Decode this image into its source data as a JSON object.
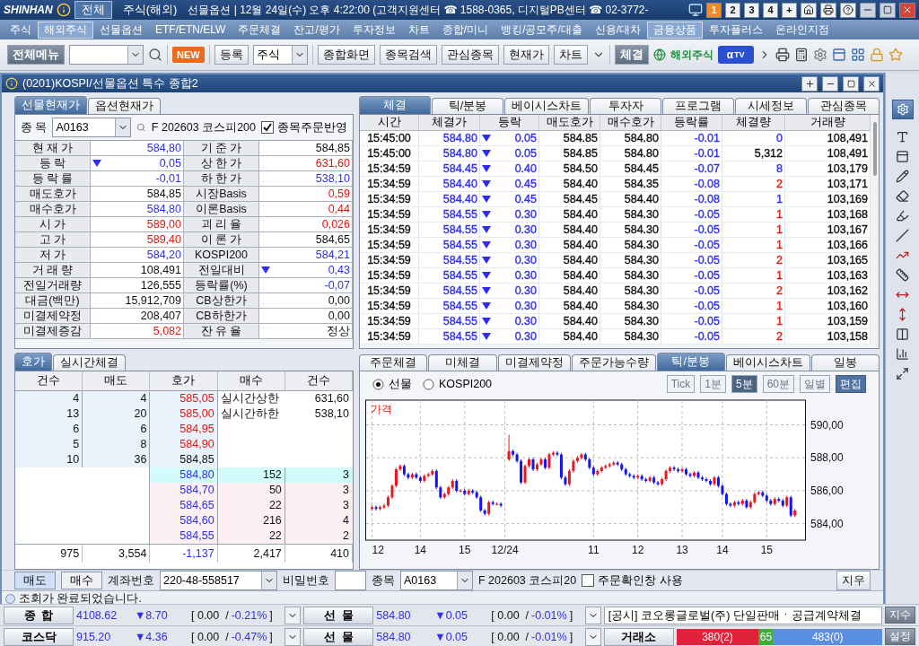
{
  "top_bar": {
    "logo": "SHINHAN",
    "tabs": [
      {
        "label": "전체",
        "selected": true
      },
      {
        "label": "주식(해외)",
        "selected": false
      }
    ],
    "info": "선물옵션 | 12월 24일(수) 오후 4:22:00 (고객지원센터 ☎ 1588-0365, 디지털PB센터 ☎ 02-3772-",
    "screens": [
      {
        "label": "1",
        "selected": true
      },
      {
        "label": "2",
        "selected": false
      },
      {
        "label": "3",
        "selected": false
      },
      {
        "label": "4",
        "selected": false
      },
      {
        "label": "+",
        "selected": false
      }
    ]
  },
  "menu": [
    {
      "label": "주식",
      "selected": false
    },
    {
      "label": "해외주식",
      "selected": true
    },
    {
      "label": "선물옵션",
      "selected": false
    },
    {
      "label": "ETF/ETN/ELW",
      "selected": false
    },
    {
      "label": "주문체결",
      "selected": false
    },
    {
      "label": "잔고/평가",
      "selected": false
    },
    {
      "label": "투자정보",
      "selected": false
    },
    {
      "label": "차트",
      "selected": false
    },
    {
      "label": "종합/미니",
      "selected": false
    },
    {
      "label": "뱅킹/공모주/대출",
      "selected": false
    },
    {
      "label": "신용/대차",
      "selected": false
    },
    {
      "label": "금융상품",
      "selected": true
    },
    {
      "label": "투자플러스",
      "selected": false
    },
    {
      "label": "온라인지점",
      "selected": false
    }
  ],
  "toolbar": {
    "all_menu": "전체메뉴",
    "new_badge": "NEW",
    "register": "등록",
    "market": "주식",
    "shortcuts": [
      "종합화면",
      "종목검색",
      "관심종목",
      "현재가",
      "차트"
    ],
    "trade": "체결",
    "overseas": "해외주식",
    "tv_logo": {
      "mark": "α",
      "label": "TV"
    }
  },
  "window": {
    "title": "(0201)KOSPI/선물옵션 특수 종합2"
  },
  "quote_panel": {
    "tabs": [
      {
        "label": "선물현재가",
        "selected": true
      },
      {
        "label": "옵션현재가",
        "selected": false
      }
    ],
    "code_label": "종 목",
    "code": "A0163",
    "name": "F 202603 코스피200",
    "reflect": {
      "label": "종목주문반영",
      "checked": true
    },
    "rows": [
      [
        {
          "label": "현 재 가",
          "value": "584,80",
          "color": "#2e2ef2"
        },
        {
          "label": "기 준 가",
          "value": "584,85",
          "color": "#111111"
        }
      ],
      [
        {
          "label": "등      락",
          "value": "0,05",
          "color": "#2e2ef2",
          "down_arrow": true
        },
        {
          "label": "상 한 가",
          "value": "631,60",
          "color": "#e3160f"
        }
      ],
      [
        {
          "label": "등 락 률",
          "value": "-0,01",
          "color": "#2e2ef2"
        },
        {
          "label": "하 한 가",
          "value": "538,10",
          "color": "#2e2ef2"
        }
      ],
      [
        {
          "label": "매도호가",
          "value": "584,85",
          "color": "#111111"
        },
        {
          "label": "시장Basis",
          "value": "0,59",
          "color": "#e3160f"
        }
      ],
      [
        {
          "label": "매수호가",
          "value": "584,80",
          "color": "#2e2ef2"
        },
        {
          "label": "이론Basis",
          "value": "0,44",
          "color": "#e3160f"
        }
      ],
      [
        {
          "label": "시      가",
          "value": "589,00",
          "color": "#e3160f"
        },
        {
          "label": "괴 리 율",
          "value": "0,026",
          "color": "#e3160f"
        }
      ],
      [
        {
          "label": "고      가",
          "value": "589,40",
          "color": "#e3160f"
        },
        {
          "label": "이 론 가",
          "value": "584,65",
          "color": "#111111"
        }
      ],
      [
        {
          "label": "저      가",
          "value": "584,20",
          "color": "#2e2ef2"
        },
        {
          "label": "KOSPI200",
          "value": "584,21",
          "color": "#2e2ef2"
        }
      ],
      [
        {
          "label": "거 래 량",
          "value": "108,491",
          "color": "#111111"
        },
        {
          "label": "전일대비",
          "value": "0,43",
          "color": "#2e2ef2",
          "down_arrow": true
        }
      ],
      [
        {
          "label": "전일거래량",
          "value": "126,555",
          "color": "#111111"
        },
        {
          "label": "등락률(%)",
          "value": "-0,07",
          "color": "#2e2ef2"
        }
      ],
      [
        {
          "label": "대금(백만)",
          "value": "15,912,709",
          "color": "#111111"
        },
        {
          "label": "CB상한가",
          "value": "0,00",
          "color": "#111111"
        }
      ],
      [
        {
          "label": "미결제약정",
          "value": "208,407",
          "color": "#111111"
        },
        {
          "label": "CB하한가",
          "value": "0,00",
          "color": "#111111"
        }
      ],
      [
        {
          "label": "미결제증감",
          "value": "5,082",
          "color": "#e3160f"
        },
        {
          "label": "잔 유 율",
          "value": "정상",
          "color": "#111111"
        }
      ]
    ]
  },
  "trades_panel": {
    "tabs": [
      {
        "label": "체결",
        "selected": true
      },
      {
        "label": "틱/분봉",
        "selected": false
      },
      {
        "label": "베이시스차트",
        "selected": false
      },
      {
        "label": "투자자",
        "selected": false
      },
      {
        "label": "프로그램",
        "selected": false
      },
      {
        "label": "시세정보",
        "selected": false
      },
      {
        "label": "관심종목",
        "selected": false
      }
    ],
    "columns": [
      "시간",
      "체결가",
      "등락",
      "매도호가",
      "매수호가",
      "등락률",
      "체결량",
      "거래량"
    ],
    "rows": [
      {
        "time": "15:45:00",
        "price": "584.80",
        "color": "#2e2ef2",
        "down_arrow": true,
        "change": "0.05",
        "ask": "584.85",
        "bid": "584.80",
        "rate": "-0.01",
        "qty": {
          "text": "0",
          "color": "#2e2ef2"
        },
        "volume": "108,491"
      },
      {
        "time": "15:45:00",
        "price": "584.80",
        "color": "#2e2ef2",
        "down_arrow": true,
        "change": "0.05",
        "ask": "584.85",
        "bid": "584.80",
        "rate": "-0.01",
        "qty": {
          "text": "5,312",
          "color": "#111111"
        },
        "volume": "108,491"
      },
      {
        "time": "15:34:59",
        "price": "584.45",
        "color": "#2e2ef2",
        "down_arrow": true,
        "change": "0.40",
        "ask": "584.50",
        "bid": "584.45",
        "rate": "-0.07",
        "qty": {
          "text": "8",
          "color": "#2e2ef2"
        },
        "volume": "103,179"
      },
      {
        "time": "15:34:59",
        "price": "584.40",
        "color": "#2e2ef2",
        "down_arrow": true,
        "change": "0.45",
        "ask": "584.40",
        "bid": "584.35",
        "rate": "-0.08",
        "qty": {
          "text": "2",
          "color": "#e3160f"
        },
        "volume": "103,171"
      },
      {
        "time": "15:34:59",
        "price": "584.40",
        "color": "#2e2ef2",
        "down_arrow": true,
        "change": "0.45",
        "ask": "584.45",
        "bid": "584.40",
        "rate": "-0.08",
        "qty": {
          "text": "1",
          "color": "#2e2ef2"
        },
        "volume": "103,169"
      },
      {
        "time": "15:34:59",
        "price": "584.55",
        "color": "#2e2ef2",
        "down_arrow": true,
        "change": "0.30",
        "ask": "584.40",
        "bid": "584.30",
        "rate": "-0.05",
        "qty": {
          "text": "1",
          "color": "#e3160f"
        },
        "volume": "103,168"
      },
      {
        "time": "15:34:59",
        "price": "584.55",
        "color": "#2e2ef2",
        "down_arrow": true,
        "change": "0.30",
        "ask": "584.40",
        "bid": "584.30",
        "rate": "-0.05",
        "qty": {
          "text": "1",
          "color": "#e3160f"
        },
        "volume": "103,167"
      },
      {
        "time": "15:34:59",
        "price": "584.55",
        "color": "#2e2ef2",
        "down_arrow": true,
        "change": "0.30",
        "ask": "584.40",
        "bid": "584.30",
        "rate": "-0.05",
        "qty": {
          "text": "1",
          "color": "#e3160f"
        },
        "volume": "103,166"
      },
      {
        "time": "15:34:59",
        "price": "584.55",
        "color": "#2e2ef2",
        "down_arrow": true,
        "change": "0.30",
        "ask": "584.40",
        "bid": "584.30",
        "rate": "-0.05",
        "qty": {
          "text": "2",
          "color": "#e3160f"
        },
        "volume": "103,165"
      },
      {
        "time": "15:34:59",
        "price": "584.55",
        "color": "#2e2ef2",
        "down_arrow": true,
        "change": "0.30",
        "ask": "584.40",
        "bid": "584.30",
        "rate": "-0.05",
        "qty": {
          "text": "1",
          "color": "#e3160f"
        },
        "volume": "103,163"
      },
      {
        "time": "15:34:59",
        "price": "584.55",
        "color": "#2e2ef2",
        "down_arrow": true,
        "change": "0.30",
        "ask": "584.40",
        "bid": "584.30",
        "rate": "-0.05",
        "qty": {
          "text": "2",
          "color": "#e3160f"
        },
        "volume": "103,162"
      },
      {
        "time": "15:34:59",
        "price": "584.55",
        "color": "#2e2ef2",
        "down_arrow": true,
        "change": "0.30",
        "ask": "584.40",
        "bid": "584.30",
        "rate": "-0.05",
        "qty": {
          "text": "1",
          "color": "#e3160f"
        },
        "volume": "103,160"
      },
      {
        "time": "15:34:59",
        "price": "584.55",
        "color": "#2e2ef2",
        "down_arrow": true,
        "change": "0.30",
        "ask": "584.40",
        "bid": "584.30",
        "rate": "-0.05",
        "qty": {
          "text": "1",
          "color": "#e3160f"
        },
        "volume": "103,159"
      },
      {
        "time": "15:34:59",
        "price": "584.55",
        "color": "#2e2ef2",
        "down_arrow": true,
        "change": "0.30",
        "ask": "584.40",
        "bid": "584.30",
        "rate": "-0.05",
        "qty": {
          "text": "2",
          "color": "#e3160f"
        },
        "volume": "103,158"
      }
    ]
  },
  "orderbook": {
    "tabs": [
      {
        "label": "호가",
        "selected": true
      },
      {
        "label": "실시간체결",
        "selected": false
      }
    ],
    "columns": [
      "건수",
      "매도",
      "호가",
      "매수",
      "건수"
    ],
    "asks": [
      {
        "count": "4",
        "qty": "4",
        "price": "585,05",
        "color": "#e3160f"
      },
      {
        "count": "13",
        "qty": "20",
        "price": "585,00",
        "color": "#e3160f"
      },
      {
        "count": "6",
        "qty": "6",
        "price": "584,95",
        "color": "#e3160f"
      },
      {
        "count": "5",
        "qty": "8",
        "price": "584,90",
        "color": "#e3160f"
      },
      {
        "count": "10",
        "qty": "36",
        "price": "584,85",
        "color": "#111111"
      }
    ],
    "limits": [
      {
        "label": "실시간상한",
        "value": "631,60"
      },
      {
        "label": "실시간하한",
        "value": "538,10"
      }
    ],
    "bids": [
      {
        "price": "584,80",
        "qty": "152",
        "count": "3",
        "color": "#2e2ef2",
        "current": true
      },
      {
        "price": "584,70",
        "qty": "50",
        "count": "3",
        "color": "#2e2ef2",
        "current": false
      },
      {
        "price": "584,65",
        "qty": "22",
        "count": "3",
        "color": "#2e2ef2",
        "current": false
      },
      {
        "price": "584,60",
        "qty": "216",
        "count": "4",
        "color": "#2e2ef2",
        "current": false
      },
      {
        "price": "584,55",
        "qty": "22",
        "count": "2",
        "color": "#2e2ef2",
        "current": false
      }
    ],
    "totals": [
      {
        "text": "975",
        "color": "#111111"
      },
      {
        "text": "3,554",
        "color": "#111111"
      },
      {
        "text": "-1,137",
        "color": "#2e2ef2"
      },
      {
        "text": "2,417",
        "color": "#111111"
      },
      {
        "text": "410",
        "color": "#111111"
      }
    ]
  },
  "chart_panel": {
    "tabs": [
      {
        "label": "주문체결",
        "selected": false
      },
      {
        "label": "미체결",
        "selected": false
      },
      {
        "label": "미결제약정",
        "selected": false
      },
      {
        "label": "주문가능수량",
        "selected": false
      },
      {
        "label": "틱/분봉",
        "selected": true
      },
      {
        "label": "베이시스차트",
        "selected": false
      },
      {
        "label": "일봉",
        "selected": false
      }
    ],
    "sources": [
      {
        "label": "선물",
        "selected": true
      },
      {
        "label": "KOSPI200",
        "selected": false
      }
    ],
    "periods": [
      {
        "label": "Tick",
        "selected": false
      },
      {
        "label": "1분",
        "selected": false
      },
      {
        "label": "5분",
        "selected": true
      },
      {
        "label": "60분",
        "selected": false
      },
      {
        "label": "일별",
        "selected": false
      }
    ],
    "edit": "편집",
    "chart_data": {
      "type": "candlestick",
      "ylabel": "가격",
      "grid": true,
      "ylim": [
        583.0,
        591.5
      ],
      "yticks": [
        {
          "value": 590,
          "label": "590,00"
        },
        {
          "value": 588,
          "label": "588,00"
        },
        {
          "value": 586,
          "label": "586,00"
        },
        {
          "value": 584,
          "label": "584,00"
        }
      ],
      "categories": [
        "12",
        null,
        null,
        null,
        null,
        null,
        null,
        null,
        null,
        null,
        null,
        null,
        "14",
        null,
        null,
        null,
        null,
        null,
        null,
        null,
        null,
        null,
        null,
        "15",
        null,
        null,
        null,
        null,
        null,
        null,
        null,
        null,
        null,
        "12/24",
        null,
        null,
        null,
        null,
        null,
        null,
        null,
        null,
        null,
        null,
        null,
        null,
        null,
        null,
        null,
        null,
        null,
        null,
        null,
        null,
        null,
        "11",
        null,
        null,
        null,
        null,
        null,
        null,
        null,
        null,
        null,
        null,
        "12",
        null,
        null,
        null,
        null,
        null,
        null,
        null,
        null,
        null,
        null,
        "13",
        null,
        null,
        null,
        null,
        null,
        null,
        null,
        null,
        null,
        "14",
        null,
        null,
        null,
        null,
        null,
        null,
        null,
        null,
        null,
        null,
        "15",
        null,
        null,
        null,
        null,
        null,
        null,
        null
      ],
      "ohlc": [
        [
          584.9,
          585.1,
          584.8,
          585.0
        ],
        [
          585.0,
          585.1,
          584.8,
          584.9
        ],
        [
          584.9,
          585.1,
          584.8,
          585.0
        ],
        [
          585.0,
          585.2,
          584.9,
          585.1
        ],
        [
          585.1,
          585.7,
          585.0,
          585.6
        ],
        [
          585.6,
          586.4,
          585.5,
          586.3
        ],
        [
          586.3,
          587.4,
          586.2,
          587.3
        ],
        [
          587.3,
          587.6,
          587.2,
          587.5
        ],
        [
          587.5,
          587.6,
          586.9,
          587.0
        ],
        [
          587.0,
          587.1,
          586.7,
          586.8
        ],
        [
          586.8,
          587.1,
          586.7,
          587.0
        ],
        [
          587.0,
          587.1,
          586.7,
          586.8
        ],
        [
          586.8,
          586.9,
          586.5,
          586.6
        ],
        [
          586.6,
          587.0,
          586.5,
          586.9
        ],
        [
          586.9,
          587.1,
          586.8,
          587.0
        ],
        [
          587.0,
          587.3,
          586.9,
          587.2
        ],
        [
          587.2,
          587.3,
          586.1,
          586.2
        ],
        [
          586.2,
          586.3,
          585.5,
          585.6
        ],
        [
          585.6,
          585.9,
          585.5,
          585.8
        ],
        [
          585.8,
          586.3,
          585.7,
          586.2
        ],
        [
          586.2,
          586.7,
          586.1,
          586.6
        ],
        [
          586.6,
          586.7,
          585.9,
          586.0
        ],
        [
          586.0,
          586.1,
          585.9,
          586.0
        ],
        [
          586.0,
          586.1,
          585.7,
          585.8
        ],
        [
          585.8,
          586.1,
          585.7,
          586.0
        ],
        [
          586.0,
          586.1,
          585.8,
          585.9
        ],
        [
          585.9,
          586.0,
          585.5,
          585.6
        ],
        [
          585.6,
          585.7,
          584.7,
          584.8
        ],
        [
          584.8,
          584.9,
          584.5,
          584.6
        ],
        [
          584.6,
          585.4,
          584.5,
          585.3
        ],
        [
          585.3,
          585.4,
          585.1,
          585.2
        ],
        [
          585.2,
          585.3,
          585.1,
          585.2
        ],
        [
          585.2,
          585.3,
          585.0,
          585.1
        ],
        null,
        [
          587.9,
          589.4,
          587.8,
          588.4
        ],
        [
          588.4,
          588.5,
          588.1,
          588.2
        ],
        [
          588.2,
          588.3,
          587.7,
          587.8
        ],
        [
          587.8,
          587.9,
          586.4,
          586.5
        ],
        [
          586.5,
          587.6,
          586.4,
          587.5
        ],
        [
          587.5,
          588.0,
          587.4,
          587.9
        ],
        [
          587.9,
          588.0,
          587.2,
          587.3
        ],
        [
          587.3,
          587.7,
          587.2,
          587.6
        ],
        [
          587.6,
          588.0,
          587.5,
          587.9
        ],
        [
          587.9,
          588.0,
          587.3,
          587.4
        ],
        [
          587.4,
          588.3,
          587.3,
          588.2
        ],
        [
          588.2,
          588.4,
          588.1,
          588.3
        ],
        [
          588.3,
          588.4,
          588.1,
          588.2
        ],
        [
          588.2,
          588.3,
          586.7,
          586.8
        ],
        [
          586.8,
          586.9,
          586.3,
          586.4
        ],
        [
          586.4,
          587.3,
          586.3,
          587.2
        ],
        [
          587.2,
          587.9,
          587.1,
          587.8
        ],
        [
          587.8,
          588.1,
          587.7,
          588.0
        ],
        [
          588.0,
          588.3,
          587.9,
          588.2
        ],
        [
          588.2,
          588.3,
          587.8,
          587.9
        ],
        [
          587.9,
          588.0,
          587.3,
          587.4
        ],
        [
          587.4,
          587.5,
          586.9,
          587.0
        ],
        [
          587.0,
          587.3,
          586.9,
          587.2
        ],
        [
          587.2,
          587.5,
          587.1,
          587.4
        ],
        [
          587.4,
          587.6,
          587.3,
          587.5
        ],
        [
          587.5,
          587.7,
          587.4,
          587.6
        ],
        [
          587.6,
          587.8,
          587.5,
          587.7
        ],
        [
          587.7,
          587.8,
          587.5,
          587.6
        ],
        [
          587.6,
          587.7,
          587.2,
          587.3
        ],
        [
          587.3,
          587.4,
          586.9,
          587.0
        ],
        [
          587.0,
          587.1,
          586.8,
          586.9
        ],
        [
          586.9,
          587.0,
          586.7,
          586.8
        ],
        [
          586.8,
          587.0,
          586.7,
          586.9
        ],
        [
          586.9,
          587.0,
          586.6,
          586.7
        ],
        [
          586.7,
          586.8,
          586.5,
          586.6
        ],
        [
          586.6,
          586.9,
          586.5,
          586.8
        ],
        [
          586.8,
          586.9,
          586.4,
          586.5
        ],
        [
          586.5,
          586.6,
          586.3,
          586.4
        ],
        [
          586.4,
          586.8,
          586.3,
          586.7
        ],
        [
          586.7,
          587.3,
          586.6,
          587.2
        ],
        [
          587.2,
          587.5,
          587.1,
          587.4
        ],
        [
          587.4,
          587.5,
          587.2,
          587.3
        ],
        [
          587.3,
          587.4,
          587.1,
          587.2
        ],
        [
          587.2,
          587.4,
          587.1,
          587.3
        ],
        [
          587.3,
          587.4,
          586.9,
          587.0
        ],
        [
          587.0,
          587.1,
          586.8,
          586.9
        ],
        [
          586.9,
          587.2,
          586.8,
          587.1
        ],
        [
          587.1,
          587.2,
          586.7,
          586.8
        ],
        [
          586.8,
          586.9,
          586.6,
          586.7
        ],
        [
          586.7,
          586.8,
          586.5,
          586.6
        ],
        [
          586.6,
          586.7,
          586.3,
          586.4
        ],
        [
          586.4,
          586.9,
          586.3,
          586.8
        ],
        [
          586.8,
          586.9,
          586.2,
          586.3
        ],
        [
          586.3,
          586.4,
          585.7,
          585.8
        ],
        [
          585.8,
          585.9,
          585.1,
          585.2
        ],
        [
          585.2,
          585.3,
          585.0,
          585.1
        ],
        [
          585.1,
          585.4,
          585.0,
          585.3
        ],
        [
          585.3,
          585.4,
          585.1,
          585.2
        ],
        [
          585.2,
          585.5,
          585.1,
          585.4
        ],
        [
          585.4,
          585.5,
          584.9,
          585.0
        ],
        [
          585.0,
          585.4,
          584.9,
          585.3
        ],
        [
          585.3,
          585.9,
          585.2,
          585.8
        ],
        [
          585.8,
          586.0,
          585.7,
          585.9
        ],
        [
          585.9,
          586.0,
          585.6,
          585.7
        ],
        [
          585.7,
          585.8,
          585.3,
          585.4
        ],
        [
          585.4,
          585.5,
          585.1,
          585.2
        ],
        [
          585.2,
          585.6,
          585.1,
          585.5
        ],
        [
          585.5,
          585.6,
          585.3,
          585.4
        ],
        [
          585.4,
          585.5,
          585.0,
          585.1
        ],
        [
          585.1,
          585.7,
          585.0,
          585.6
        ],
        [
          585.6,
          585.7,
          584.4,
          584.5
        ],
        [
          584.5,
          584.9,
          584.4,
          584.8
        ]
      ]
    }
  },
  "order_bar": {
    "sides": [
      {
        "label": "매도",
        "selected": true
      },
      {
        "label": "매수",
        "selected": false
      }
    ],
    "account_label": "계좌번호",
    "account": "220-48-558517",
    "password_label": "비밀번호",
    "code_label": "종목",
    "code": "A0163",
    "name": "F 202603 코스피20",
    "confirm": {
      "label": "주문확인창 사용",
      "checked": false
    },
    "clear": "지우"
  },
  "status": "조회가 완료되었습니다.",
  "ticker_rows": [
    {
      "index": {
        "name": "종  합",
        "value": "4108.62",
        "change": "▼8.70",
        "bracket": "[ 0.00  /",
        "rate": "-0.21%",
        "close": "]"
      },
      "futures": {
        "name": "선  물",
        "value": "584.80",
        "change": "▼0.05",
        "bracket": "[ 0.00  /",
        "rate": "-0.01%",
        "close": "]"
      },
      "kind": "news",
      "news": "[공시] 코오롱글로벌(주) 단일판매ㆍ공급계약체결",
      "button": "지수"
    },
    {
      "index": {
        "name": "코스닥",
        "value": "915.20",
        "change": "▼4.36",
        "bracket": "[ 0.00  /",
        "rate": "-0.47%",
        "close": "]"
      },
      "futures": {
        "name": "선  물",
        "value": "584.80",
        "change": "▼0.05",
        "bracket": "[ 0.00  /",
        "rate": "-0.01%",
        "close": "]"
      },
      "kind": "breadth",
      "breadth": {
        "label": "거래소",
        "segments": [
          {
            "text": "380(2)",
            "color": "#e0233a"
          },
          {
            "text": "65",
            "color": "#3cae34"
          },
          {
            "text": "483(0)",
            "color": "#5a8ee0"
          }
        ]
      },
      "button": "설정"
    }
  ]
}
